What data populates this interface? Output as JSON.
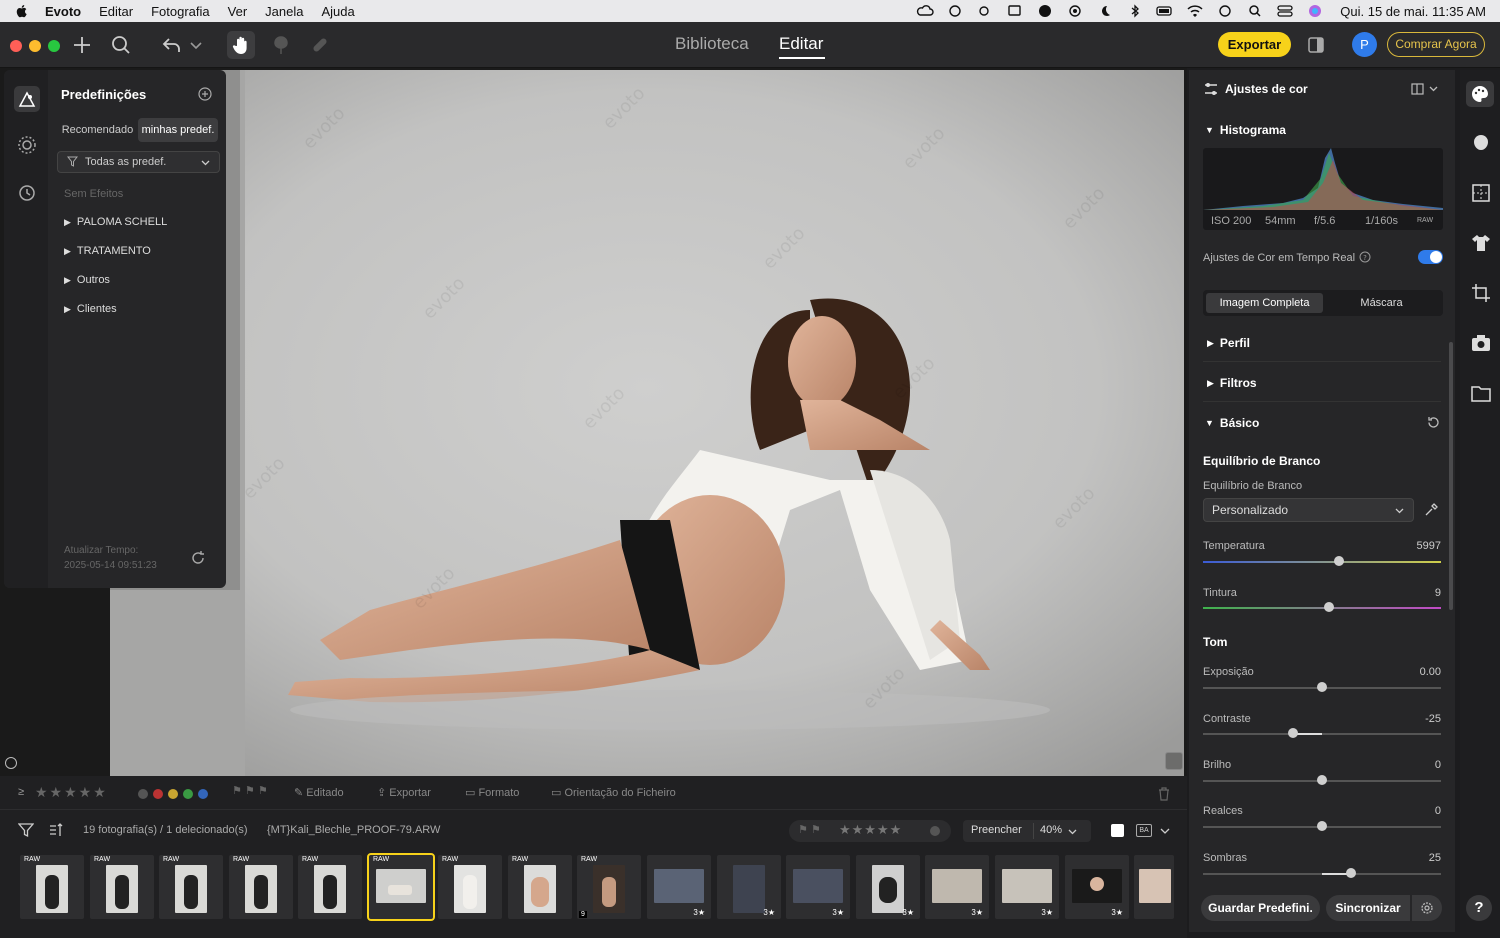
{
  "menubar": {
    "app_name": "Evoto",
    "items": [
      "Editar",
      "Fotografia",
      "Ver",
      "Janela",
      "Ajuda"
    ],
    "clock": "Qui. 15 de mai.  11:35 AM"
  },
  "toolbar": {
    "tab_library": "Biblioteca",
    "tab_edit": "Editar",
    "export_label": "Exportar",
    "avatar_initial": "P",
    "buy_label": "Comprar Agora"
  },
  "presets": {
    "title": "Predefinições",
    "tab_recommended": "Recomendado",
    "tab_mine": "minhas predef.",
    "filter_value": "Todas as predef.",
    "no_effects": "Sem Efeitos",
    "folders": [
      "PALOMA SCHELL",
      "TRATAMENTO",
      "Outros",
      "Clientes"
    ],
    "update_label": "Atualizar Tempo:",
    "update_time": "2025-05-14 09:51:23"
  },
  "watermark": "evoto",
  "adjust": {
    "title": "Ajustes de cor",
    "histogram_title": "Histograma",
    "histogram_info": [
      "ISO 200",
      "54mm",
      "f/5.6",
      "1/160s"
    ],
    "histogram_raw": "RAW",
    "realtime_label": "Ajustes de Cor em Tempo Real",
    "realtime_on": true,
    "seg_full": "Imagem Completa",
    "seg_mask": "Máscara",
    "section_profile": "Perfil",
    "section_filters": "Filtros",
    "section_basic": "Básico",
    "wb_title": "Equilíbrio de Branco",
    "wb_label": "Equilíbrio de Branco",
    "wb_value": "Personalizado",
    "temperature_label": "Temperatura",
    "temperature_value": "5997",
    "tint_label": "Tintura",
    "tint_value": "9",
    "tone_title": "Tom",
    "exposure_label": "Exposição",
    "exposure_value": "0.00",
    "contrast_label": "Contraste",
    "contrast_value": "-25",
    "brightness_label": "Brilho",
    "brightness_value": "0",
    "highlights_label": "Realces",
    "highlights_value": "0",
    "shadows_label": "Sombras",
    "shadows_value": "25",
    "save_label": "Guardar Predefini.",
    "sync_label": "Sincronizar"
  },
  "sliders": {
    "temperature": 0.57,
    "tint": 0.53,
    "exposure": 0.5,
    "contrast": 0.38,
    "brightness": 0.5,
    "highlights": 0.5,
    "shadows": 0.62
  },
  "filterbar": {
    "edited": "Editado",
    "export": "Exportar",
    "format": "Formato",
    "orientation": "Orientação do Ficheiro"
  },
  "filmstrip": {
    "count_label": "19 fotografia(s) / 1 delecionado(s)",
    "filename": "{MT}Kali_Blechle_PROOF-79.ARW",
    "fill_label": "Preencher",
    "zoom": "40%",
    "ba_label": "BA",
    "raw_tag": "RAW",
    "stack_count": "9",
    "rating_label": "3★"
  },
  "colors": {
    "accent": "#f7d21a",
    "toggle": "#2f7bea"
  }
}
